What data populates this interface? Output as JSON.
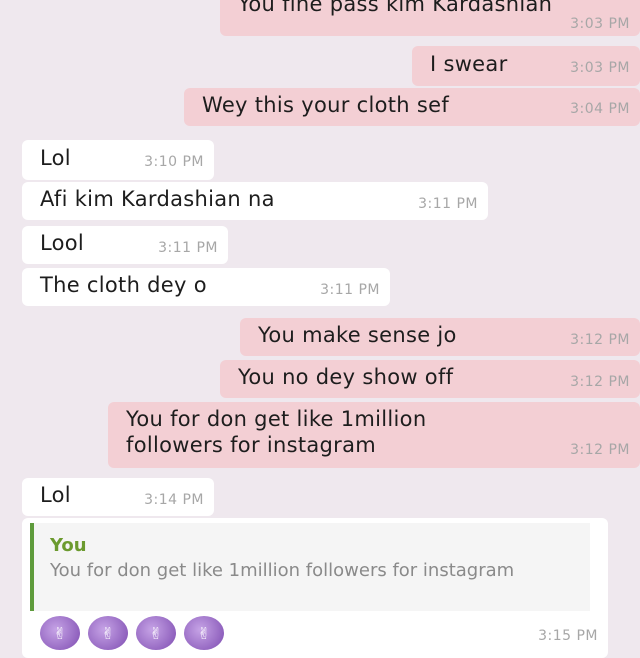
{
  "messages": [
    {
      "text": "You fine pass kim Kardashian",
      "time": "3:03 PM",
      "dir": "out"
    },
    {
      "text": "I swear",
      "time": "3:03 PM",
      "dir": "out"
    },
    {
      "text": "Wey this your cloth sef",
      "time": "3:04 PM",
      "dir": "out"
    },
    {
      "text": "Lol",
      "time": "3:10 PM",
      "dir": "in"
    },
    {
      "text": "Afi kim Kardashian na",
      "time": "3:11 PM",
      "dir": "in"
    },
    {
      "text": "Lool",
      "time": "3:11 PM",
      "dir": "in"
    },
    {
      "text": "The cloth dey o",
      "time": "3:11 PM",
      "dir": "in"
    },
    {
      "text": "You make sense jo",
      "time": "3:12 PM",
      "dir": "out"
    },
    {
      "text": "You no dey show off",
      "time": "3:12 PM",
      "dir": "out"
    },
    {
      "text_line1": "You for don get like 1million",
      "text_line2": "followers for instagram",
      "time": "3:12 PM",
      "dir": "out"
    },
    {
      "text": "Lol",
      "time": "3:14 PM",
      "dir": "in"
    }
  ],
  "reply": {
    "author": "You",
    "quote": "You for don get like 1million followers for instagram",
    "time": "3:15 PM"
  },
  "sticker_icon": "emoji-sticker-icon",
  "colors": {
    "background": "#efe8ee",
    "outgoing": "#f3cfd4",
    "incoming": "#ffffff",
    "quote_accent": "#5e9b3c"
  }
}
